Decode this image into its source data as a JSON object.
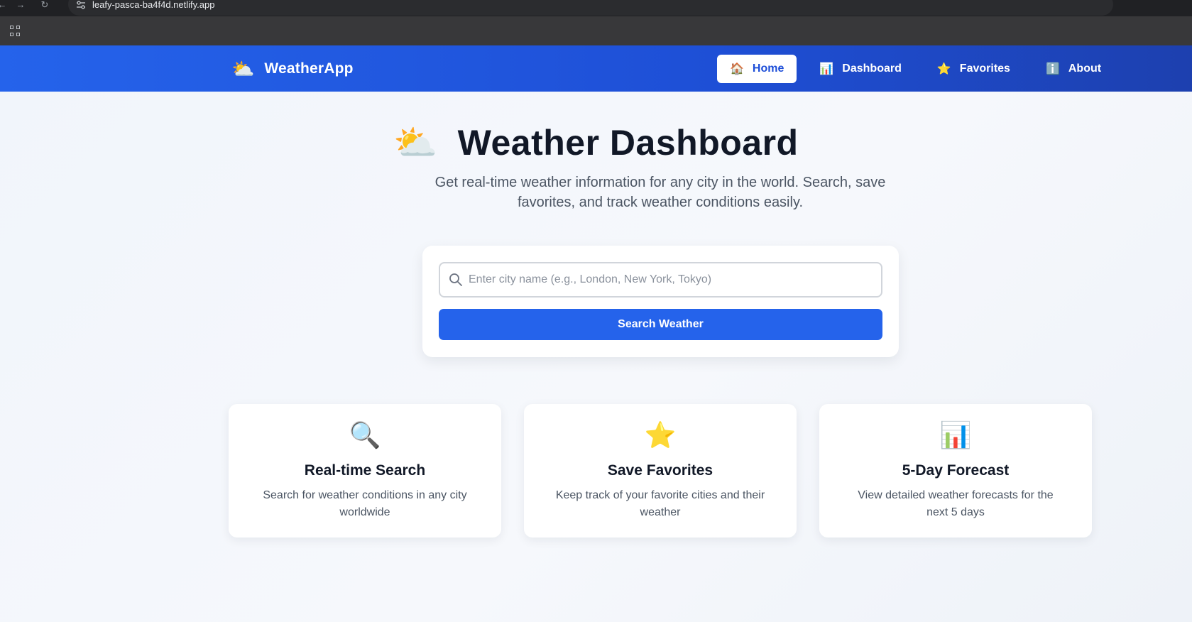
{
  "browser": {
    "url": "leafy-pasca-ba4f4d.netlify.app",
    "back_icon": "back-arrow-icon",
    "forward_icon": "forward-arrow-icon",
    "reload_icon": "reload-icon",
    "site_info_icon": "site-settings-icon",
    "apps_icon": "apps-grid-icon"
  },
  "header": {
    "brand_icon": "⛅",
    "brand_name": "WeatherApp",
    "nav": [
      {
        "icon": "🏠",
        "label": "Home",
        "active": true
      },
      {
        "icon": "📊",
        "label": "Dashboard",
        "active": false
      },
      {
        "icon": "⭐",
        "label": "Favorites",
        "active": false
      },
      {
        "icon": "ℹ️",
        "label": "About",
        "active": false
      }
    ]
  },
  "hero": {
    "icon": "⛅",
    "title": "Weather Dashboard",
    "subtitle": "Get real-time weather information for any city in the world. Search, save favorites, and track weather conditions easily."
  },
  "search": {
    "placeholder": "Enter city name (e.g., London, New York, Tokyo)",
    "value": "",
    "button_label": "Search Weather"
  },
  "features": [
    {
      "icon": "🔍",
      "title": "Real-time Search",
      "description": "Search for weather conditions in any city worldwide"
    },
    {
      "icon": "⭐",
      "title": "Save Favorites",
      "description": "Keep track of your favorite cities and their weather"
    },
    {
      "icon": "📊",
      "title": "5-Day Forecast",
      "description": "View detailed weather forecasts for the next 5 days"
    }
  ],
  "colors": {
    "primary": "#2563eb",
    "header_end": "#1d40af",
    "title": "#111827",
    "muted_text": "#4b5563"
  }
}
